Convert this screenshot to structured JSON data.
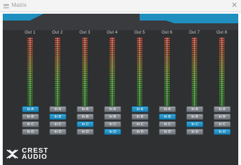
{
  "window": {
    "title": "Matrix",
    "close_glyph": "✕"
  },
  "brand": {
    "line1": "CREST",
    "line2": "AUDIO"
  },
  "channels": [
    {
      "label": "Out 1",
      "buttons": [
        {
          "label": "In A",
          "active": true
        },
        {
          "label": "In B",
          "active": false
        },
        {
          "label": "In C",
          "active": false
        },
        {
          "label": "In D",
          "active": false
        }
      ]
    },
    {
      "label": "Out 2",
      "buttons": [
        {
          "label": "In A",
          "active": false
        },
        {
          "label": "In B",
          "active": true
        },
        {
          "label": "In C",
          "active": false
        },
        {
          "label": "In D",
          "active": false
        }
      ]
    },
    {
      "label": "Out 3",
      "buttons": [
        {
          "label": "In A",
          "active": false
        },
        {
          "label": "In B",
          "active": false
        },
        {
          "label": "In C",
          "active": true
        },
        {
          "label": "In D",
          "active": false
        }
      ]
    },
    {
      "label": "Out 4",
      "buttons": [
        {
          "label": "In A",
          "active": false
        },
        {
          "label": "In B",
          "active": false
        },
        {
          "label": "In C",
          "active": false
        },
        {
          "label": "In D",
          "active": true
        }
      ]
    },
    {
      "label": "Out 5",
      "buttons": [
        {
          "label": "In A",
          "active": true
        },
        {
          "label": "In B",
          "active": false
        },
        {
          "label": "In C",
          "active": false
        },
        {
          "label": "In D",
          "active": false
        }
      ]
    },
    {
      "label": "Out 6",
      "buttons": [
        {
          "label": "In A",
          "active": false
        },
        {
          "label": "In B",
          "active": true
        },
        {
          "label": "In C",
          "active": false
        },
        {
          "label": "In D",
          "active": false
        }
      ]
    },
    {
      "label": "Out 7",
      "buttons": [
        {
          "label": "In A",
          "active": false
        },
        {
          "label": "In B",
          "active": false
        },
        {
          "label": "In C",
          "active": true
        },
        {
          "label": "In D",
          "active": false
        }
      ]
    },
    {
      "label": "Out 8",
      "buttons": [
        {
          "label": "In A",
          "active": false
        },
        {
          "label": "In B",
          "active": false
        },
        {
          "label": "In C",
          "active": false
        },
        {
          "label": "In D",
          "active": true
        }
      ]
    }
  ],
  "colors": {
    "active": "#2a93c6",
    "inactive": "#7d8389",
    "panel": "#2f3032",
    "accent": "#1f8fc0"
  }
}
